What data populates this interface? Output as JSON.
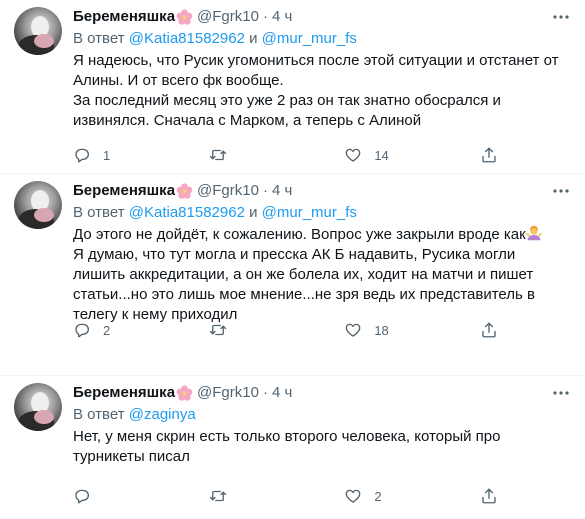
{
  "tweets": [
    {
      "name": "Беременяшка",
      "handle": "@Fgrk10",
      "dot": "·",
      "time": "4 ч",
      "reply_prefix": "В ответ",
      "mentions": [
        "@Katia81582962",
        "@mur_mur_fs"
      ],
      "mention_joiner": "и",
      "lines": [
        "Я надеюсь, что Русик угомониться после этой ситуации и отстанет от Алины. И от всего фк вообще.",
        "За последний месяц это уже 2 раз он так знатно обосрался и извинялся. Сначала с Марком, а теперь с Алиной"
      ],
      "counts": {
        "reply": "1",
        "retweet": "",
        "like": "14"
      }
    },
    {
      "name": "Беременяшка",
      "handle": "@Fgrk10",
      "dot": "·",
      "time": "4 ч",
      "reply_prefix": "В ответ",
      "mentions": [
        "@Katia81582962",
        "@mur_mur_fs"
      ],
      "mention_joiner": "и",
      "lines": [
        "До этого не дойдёт, к сожалению. Вопрос уже закрыли вроде как",
        "Я думаю, что тут могла и пресска АК Б надавить, Русика могли лишить аккредитации, а он же болела их, ходит на матчи и пишет статьи...но это лишь мое мнение...не зря ведь их представитель в телегу к нему приходил"
      ],
      "counts": {
        "reply": "2",
        "retweet": "",
        "like": "18"
      }
    },
    {
      "name": "Беременяшка",
      "handle": "@Fgrk10",
      "dot": "·",
      "time": "4 ч",
      "reply_prefix": "В ответ",
      "mentions": [
        "@zaginya"
      ],
      "mention_joiner": "",
      "lines": [
        "Нет, у меня скрин есть только второго человека, который про турникеты писал"
      ],
      "counts": {
        "reply": "",
        "retweet": "",
        "like": "2"
      }
    }
  ],
  "icons": {
    "more": "more-dots-icon",
    "reply": "reply-bubble-icon",
    "retweet": "retweet-icon",
    "like": "heart-icon",
    "share": "share-icon",
    "flower": "cherry-blossom-icon",
    "shrug": "person-shrugging-icon"
  },
  "colors": {
    "link": "#1d9bf0",
    "secondary_text": "#536471",
    "primary_text": "#0f1419",
    "divider": "#eff3f4"
  }
}
